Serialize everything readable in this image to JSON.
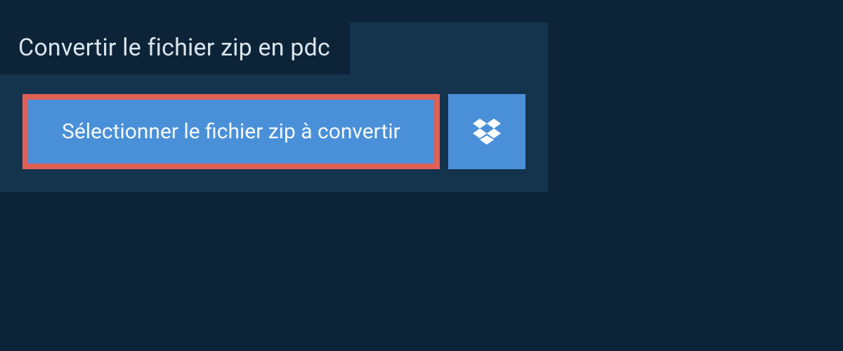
{
  "heading": "Convertir le fichier zip en pdc",
  "buttons": {
    "select_label": "Sélectionner le fichier zip à convertir"
  },
  "colors": {
    "background": "#0d2438",
    "panel": "#14344d",
    "button_bg": "#4a90d9",
    "button_border": "#e06055",
    "text_light": "#dbe5ec"
  }
}
